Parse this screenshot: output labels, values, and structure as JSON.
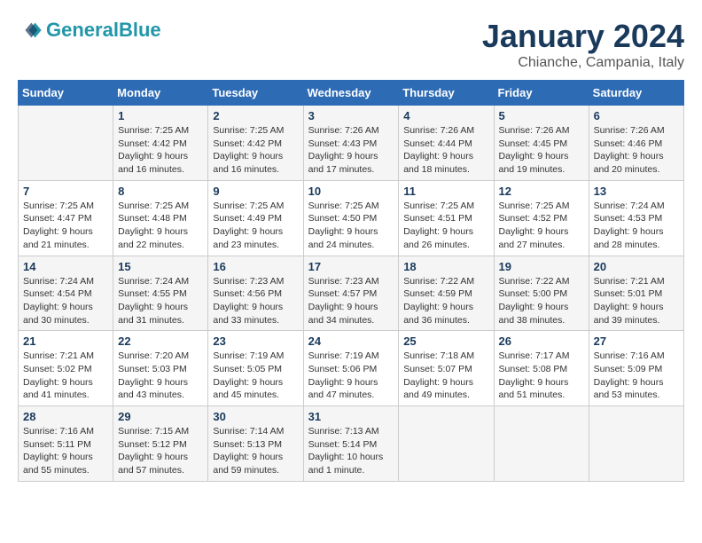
{
  "logo": {
    "line1": "General",
    "line2": "Blue"
  },
  "title": "January 2024",
  "subtitle": "Chianche, Campania, Italy",
  "weekdays": [
    "Sunday",
    "Monday",
    "Tuesday",
    "Wednesday",
    "Thursday",
    "Friday",
    "Saturday"
  ],
  "weeks": [
    [
      {
        "day": "",
        "info": ""
      },
      {
        "day": "1",
        "info": "Sunrise: 7:25 AM\nSunset: 4:42 PM\nDaylight: 9 hours\nand 16 minutes."
      },
      {
        "day": "2",
        "info": "Sunrise: 7:25 AM\nSunset: 4:42 PM\nDaylight: 9 hours\nand 16 minutes."
      },
      {
        "day": "3",
        "info": "Sunrise: 7:26 AM\nSunset: 4:43 PM\nDaylight: 9 hours\nand 17 minutes."
      },
      {
        "day": "4",
        "info": "Sunrise: 7:26 AM\nSunset: 4:44 PM\nDaylight: 9 hours\nand 18 minutes."
      },
      {
        "day": "5",
        "info": "Sunrise: 7:26 AM\nSunset: 4:45 PM\nDaylight: 9 hours\nand 19 minutes."
      },
      {
        "day": "6",
        "info": "Sunrise: 7:26 AM\nSunset: 4:46 PM\nDaylight: 9 hours\nand 20 minutes."
      }
    ],
    [
      {
        "day": "7",
        "info": ""
      },
      {
        "day": "8",
        "info": "Sunrise: 7:25 AM\nSunset: 4:48 PM\nDaylight: 9 hours\nand 22 minutes."
      },
      {
        "day": "9",
        "info": "Sunrise: 7:25 AM\nSunset: 4:49 PM\nDaylight: 9 hours\nand 23 minutes."
      },
      {
        "day": "10",
        "info": "Sunrise: 7:25 AM\nSunset: 4:50 PM\nDaylight: 9 hours\nand 24 minutes."
      },
      {
        "day": "11",
        "info": "Sunrise: 7:25 AM\nSunset: 4:51 PM\nDaylight: 9 hours\nand 26 minutes."
      },
      {
        "day": "12",
        "info": "Sunrise: 7:25 AM\nSunset: 4:52 PM\nDaylight: 9 hours\nand 27 minutes."
      },
      {
        "day": "13",
        "info": "Sunrise: 7:24 AM\nSunset: 4:53 PM\nDaylight: 9 hours\nand 28 minutes."
      }
    ],
    [
      {
        "day": "14",
        "info": "Sunrise: 7:24 AM\nSunset: 4:54 PM\nDaylight: 9 hours\nand 30 minutes."
      },
      {
        "day": "15",
        "info": "Sunrise: 7:24 AM\nSunset: 4:55 PM\nDaylight: 9 hours\nand 31 minutes."
      },
      {
        "day": "16",
        "info": "Sunrise: 7:23 AM\nSunset: 4:56 PM\nDaylight: 9 hours\nand 33 minutes."
      },
      {
        "day": "17",
        "info": "Sunrise: 7:23 AM\nSunset: 4:57 PM\nDaylight: 9 hours\nand 34 minutes."
      },
      {
        "day": "18",
        "info": "Sunrise: 7:22 AM\nSunset: 4:59 PM\nDaylight: 9 hours\nand 36 minutes."
      },
      {
        "day": "19",
        "info": "Sunrise: 7:22 AM\nSunset: 5:00 PM\nDaylight: 9 hours\nand 38 minutes."
      },
      {
        "day": "20",
        "info": "Sunrise: 7:21 AM\nSunset: 5:01 PM\nDaylight: 9 hours\nand 39 minutes."
      }
    ],
    [
      {
        "day": "21",
        "info": "Sunrise: 7:21 AM\nSunset: 5:02 PM\nDaylight: 9 hours\nand 41 minutes."
      },
      {
        "day": "22",
        "info": "Sunrise: 7:20 AM\nSunset: 5:03 PM\nDaylight: 9 hours\nand 43 minutes."
      },
      {
        "day": "23",
        "info": "Sunrise: 7:19 AM\nSunset: 5:05 PM\nDaylight: 9 hours\nand 45 minutes."
      },
      {
        "day": "24",
        "info": "Sunrise: 7:19 AM\nSunset: 5:06 PM\nDaylight: 9 hours\nand 47 minutes."
      },
      {
        "day": "25",
        "info": "Sunrise: 7:18 AM\nSunset: 5:07 PM\nDaylight: 9 hours\nand 49 minutes."
      },
      {
        "day": "26",
        "info": "Sunrise: 7:17 AM\nSunset: 5:08 PM\nDaylight: 9 hours\nand 51 minutes."
      },
      {
        "day": "27",
        "info": "Sunrise: 7:16 AM\nSunset: 5:09 PM\nDaylight: 9 hours\nand 53 minutes."
      }
    ],
    [
      {
        "day": "28",
        "info": "Sunrise: 7:16 AM\nSunset: 5:11 PM\nDaylight: 9 hours\nand 55 minutes."
      },
      {
        "day": "29",
        "info": "Sunrise: 7:15 AM\nSunset: 5:12 PM\nDaylight: 9 hours\nand 57 minutes."
      },
      {
        "day": "30",
        "info": "Sunrise: 7:14 AM\nSunset: 5:13 PM\nDaylight: 9 hours\nand 59 minutes."
      },
      {
        "day": "31",
        "info": "Sunrise: 7:13 AM\nSunset: 5:14 PM\nDaylight: 10 hours\nand 1 minute."
      },
      {
        "day": "",
        "info": ""
      },
      {
        "day": "",
        "info": ""
      },
      {
        "day": "",
        "info": ""
      }
    ]
  ],
  "week7_sunday": {
    "day": "7",
    "info": "Sunrise: 7:25 AM\nSunset: 4:47 PM\nDaylight: 9 hours\nand 21 minutes."
  }
}
